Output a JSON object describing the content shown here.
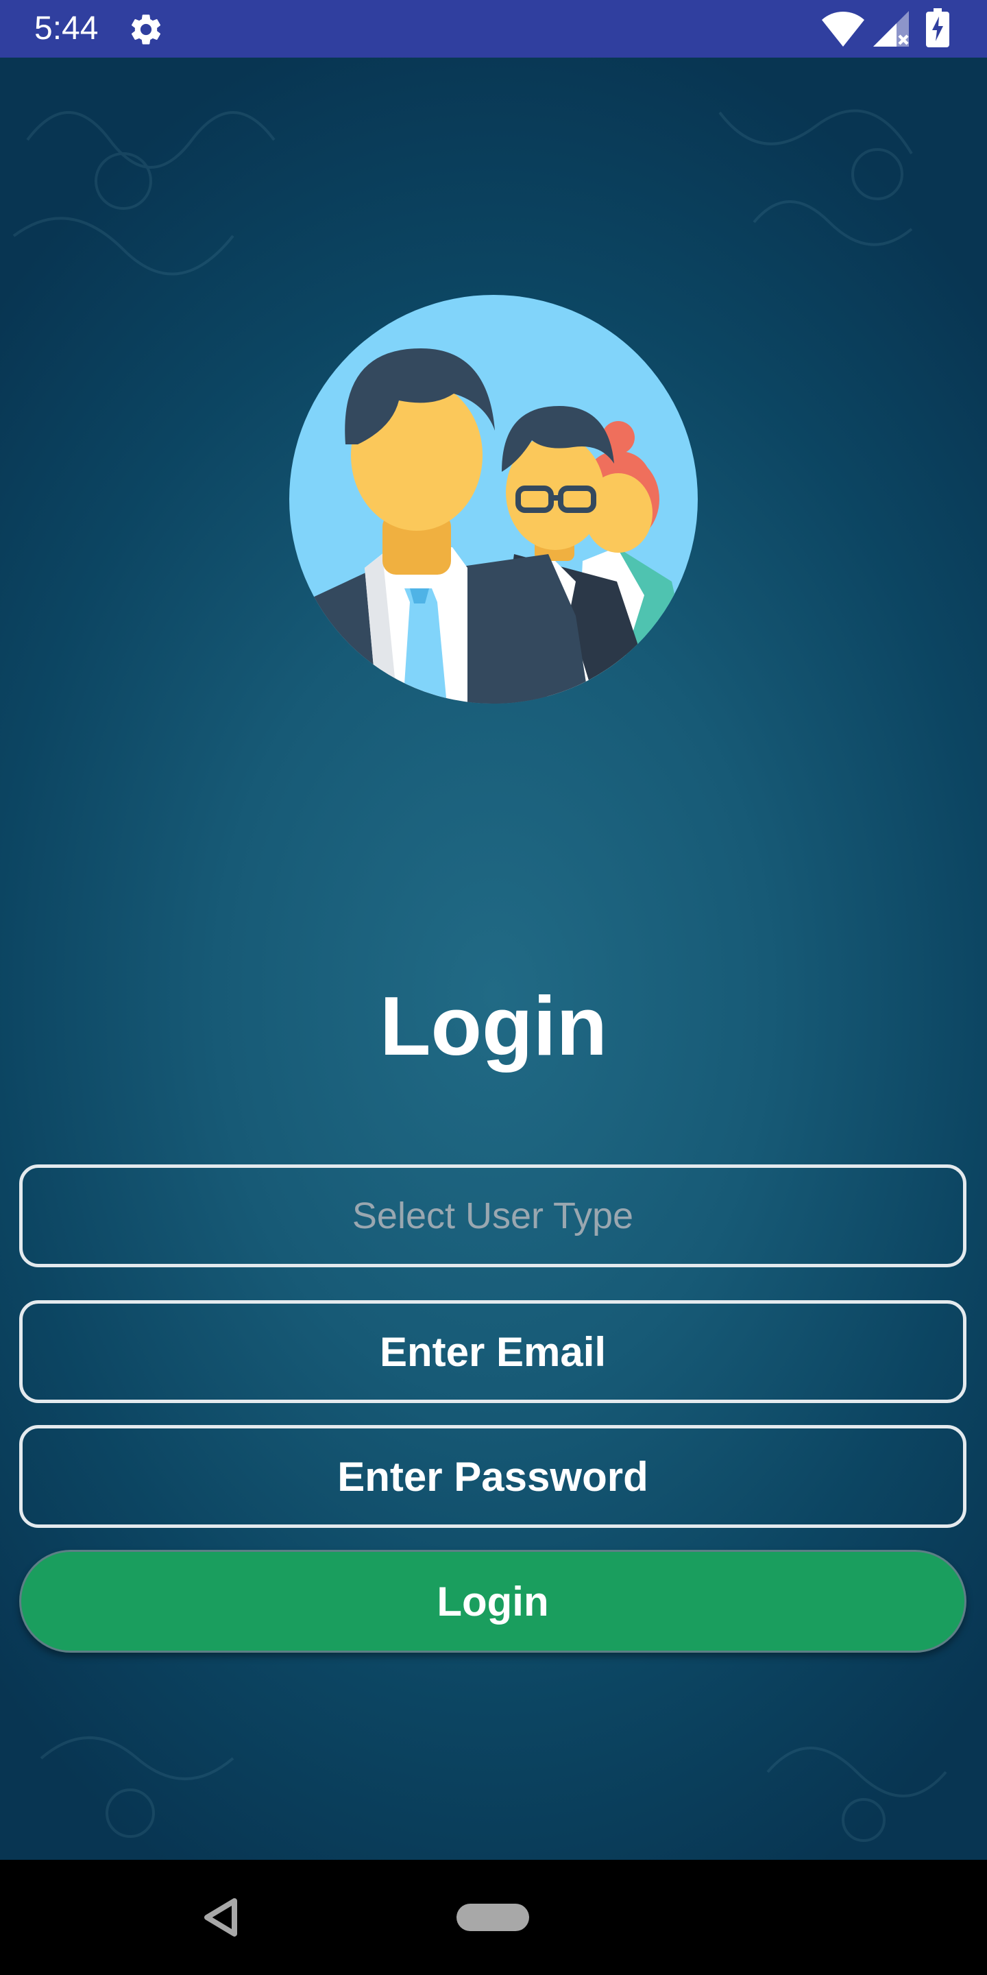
{
  "status_bar": {
    "time": "5:44",
    "icons": [
      "settings-gear-icon",
      "wifi-icon",
      "signal-icon",
      "battery-charging-icon"
    ],
    "background_color": "#303f9f"
  },
  "login": {
    "title": "Login",
    "avatar_icon": "team-users-avatar-icon",
    "user_type_placeholder": "Select User Type",
    "email_placeholder": "Enter Email",
    "password_placeholder": "Enter Password",
    "submit_label": "Login",
    "button_color": "#1a9e5e",
    "field_border_color": "#e4eaee"
  },
  "nav_bar": {
    "icons": [
      "back-icon",
      "home-pill-icon"
    ]
  }
}
